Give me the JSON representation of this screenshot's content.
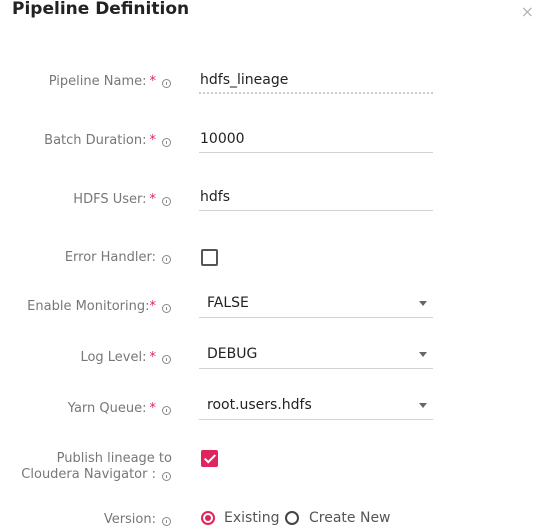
{
  "dialog": {
    "title": "Pipeline Definition",
    "close_icon": "×"
  },
  "form": {
    "required_mark": "*",
    "pipeline_name": {
      "label": "Pipeline Name:",
      "value": "hdfs_lineage",
      "required": true
    },
    "batch_duration": {
      "label": "Batch Duration:",
      "value": "10000",
      "required": true
    },
    "hdfs_user": {
      "label": "HDFS User:",
      "value": "hdfs",
      "required": true
    },
    "error_handler": {
      "label": "Error Handler:",
      "checked": false
    },
    "enable_monitoring": {
      "label": "Enable Monitoring:",
      "value": "FALSE",
      "required": true
    },
    "log_level": {
      "label": "Log Level:",
      "value": "DEBUG",
      "required": true
    },
    "yarn_queue": {
      "label": "Yarn Queue:",
      "value": "root.users.hdfs",
      "required": true
    },
    "publish_lineage": {
      "label_line1": "Publish lineage to",
      "label_line2": "Cloudera Navigator :",
      "checked": true
    },
    "version": {
      "label": "Version:",
      "options": [
        {
          "label": "Existing",
          "selected": true
        },
        {
          "label": "Create New",
          "selected": false
        }
      ]
    }
  },
  "colors": {
    "accent": "#e0245e",
    "label": "#777777"
  }
}
